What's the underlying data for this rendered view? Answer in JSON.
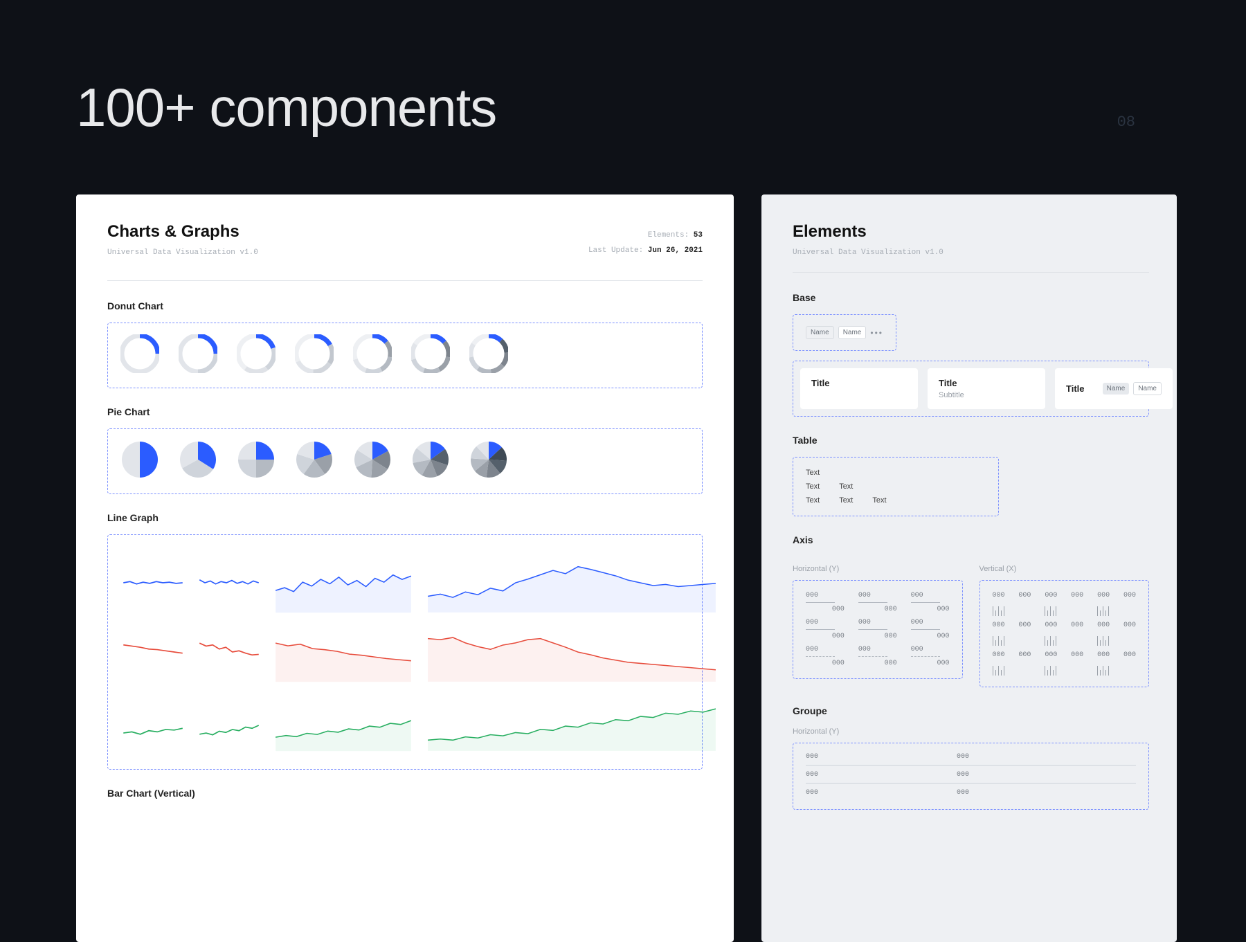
{
  "hero": {
    "title": "100+ components",
    "page_number": "08"
  },
  "left_panel": {
    "title": "Charts & Graphs",
    "subtitle": "Universal Data Visualization v1.0",
    "elements_label": "Elements:",
    "elements_count": "53",
    "update_label": "Last Update:",
    "update_value": "Jun 26, 2021",
    "sections": {
      "donut": "Donut Chart",
      "pie": "Pie Chart",
      "line": "Line Graph",
      "bar_v": "Bar Chart (Vertical)"
    }
  },
  "right_panel": {
    "title": "Elements",
    "subtitle": "Universal Data Visualization v1.0",
    "base": {
      "heading": "Base",
      "chip1": "Name",
      "chip2": "Name",
      "dots": "•••"
    },
    "cards": {
      "c1_title": "Title",
      "c2_title": "Title",
      "c2_sub": "Subtitle",
      "c3_title": "Title",
      "c3_tag1": "Name",
      "c3_tag2": "Name"
    },
    "table": {
      "heading": "Table",
      "cells": [
        "Text",
        "Text",
        "Text",
        "Text",
        "Text",
        "Text"
      ]
    },
    "axis": {
      "heading": "Axis",
      "hlabel": "Horizontal (Y)",
      "vlabel": "Vertical (X)",
      "placeholder": "000"
    },
    "groupe": {
      "heading": "Groupe",
      "sub": "Horizontal (Y)",
      "placeholder": "000"
    }
  },
  "colors": {
    "blue": "#2b5cff",
    "red": "#e74c3c",
    "green": "#27ae60",
    "grey1": "#a7adb5",
    "grey2": "#7d848d",
    "grey3": "#55606b",
    "light": "#e2e5ea"
  },
  "chart_data": [
    {
      "type": "pie",
      "note": "Donut chart variants (ring style). Values approximate filled-arc fractions; segments list slice colors.",
      "variants": [
        {
          "segments": [
            {
              "color": "#2b5cff",
              "value": 25
            },
            {
              "color": "#e2e5ea",
              "value": 75
            }
          ],
          "donut": true
        },
        {
          "segments": [
            {
              "color": "#2b5cff",
              "value": 25
            },
            {
              "color": "#cfd4db",
              "value": 25
            },
            {
              "color": "#e2e5ea",
              "value": 50
            }
          ],
          "donut": true
        },
        {
          "segments": [
            {
              "color": "#2b5cff",
              "value": 20
            },
            {
              "color": "#cfd4db",
              "value": 20
            },
            {
              "color": "#dfe2e7",
              "value": 20
            },
            {
              "color": "#eef0f3",
              "value": 40
            }
          ],
          "donut": true
        },
        {
          "segments": [
            {
              "color": "#2b5cff",
              "value": 17
            },
            {
              "color": "#c2c7ce",
              "value": 17
            },
            {
              "color": "#d2d6dc",
              "value": 17
            },
            {
              "color": "#e2e5ea",
              "value": 17
            },
            {
              "color": "#eef0f3",
              "value": 32
            }
          ],
          "donut": true
        },
        {
          "segments": [
            {
              "color": "#2b5cff",
              "value": 14
            },
            {
              "color": "#9aa0a8",
              "value": 14
            },
            {
              "color": "#b4bac2",
              "value": 14
            },
            {
              "color": "#cfd4db",
              "value": 14
            },
            {
              "color": "#e2e5ea",
              "value": 14
            },
            {
              "color": "#eef0f3",
              "value": 30
            }
          ],
          "donut": true
        },
        {
          "segments": [
            {
              "color": "#2b5cff",
              "value": 14
            },
            {
              "color": "#7d848d",
              "value": 14
            },
            {
              "color": "#9aa0a8",
              "value": 14
            },
            {
              "color": "#b4bac2",
              "value": 14
            },
            {
              "color": "#cfd4db",
              "value": 14
            },
            {
              "color": "#e2e5ea",
              "value": 14
            },
            {
              "color": "#eef0f3",
              "value": 16
            }
          ],
          "donut": true
        },
        {
          "segments": [
            {
              "color": "#2b5cff",
              "value": 12
            },
            {
              "color": "#55606b",
              "value": 12
            },
            {
              "color": "#7d848d",
              "value": 12
            },
            {
              "color": "#9aa0a8",
              "value": 12
            },
            {
              "color": "#b4bac2",
              "value": 12
            },
            {
              "color": "#cfd4db",
              "value": 12
            },
            {
              "color": "#e2e5ea",
              "value": 12
            },
            {
              "color": "#eef0f3",
              "value": 16
            }
          ],
          "donut": true
        }
      ]
    },
    {
      "type": "pie",
      "note": "Solid pie chart variants; equal slices unless blue lead wedge larger.",
      "variants": [
        {
          "segments": [
            {
              "color": "#2b5cff",
              "value": 50
            },
            {
              "color": "#e2e5ea",
              "value": 50
            }
          ]
        },
        {
          "segments": [
            {
              "color": "#2b5cff",
              "value": 34
            },
            {
              "color": "#cfd4db",
              "value": 33
            },
            {
              "color": "#e2e5ea",
              "value": 33
            }
          ]
        },
        {
          "segments": [
            {
              "color": "#2b5cff",
              "value": 25
            },
            {
              "color": "#b4bac2",
              "value": 25
            },
            {
              "color": "#cfd4db",
              "value": 25
            },
            {
              "color": "#e2e5ea",
              "value": 25
            }
          ]
        },
        {
          "segments": [
            {
              "color": "#2b5cff",
              "value": 20
            },
            {
              "color": "#9aa0a8",
              "value": 20
            },
            {
              "color": "#b4bac2",
              "value": 20
            },
            {
              "color": "#cfd4db",
              "value": 20
            },
            {
              "color": "#e2e5ea",
              "value": 20
            }
          ]
        },
        {
          "segments": [
            {
              "color": "#2b5cff",
              "value": 17
            },
            {
              "color": "#7d848d",
              "value": 17
            },
            {
              "color": "#9aa0a8",
              "value": 17
            },
            {
              "color": "#b4bac2",
              "value": 17
            },
            {
              "color": "#cfd4db",
              "value": 16
            },
            {
              "color": "#e2e5ea",
              "value": 16
            }
          ]
        },
        {
          "segments": [
            {
              "color": "#2b5cff",
              "value": 15
            },
            {
              "color": "#55606b",
              "value": 15
            },
            {
              "color": "#7d848d",
              "value": 14
            },
            {
              "color": "#9aa0a8",
              "value": 14
            },
            {
              "color": "#b4bac2",
              "value": 14
            },
            {
              "color": "#cfd4db",
              "value": 14
            },
            {
              "color": "#e2e5ea",
              "value": 14
            }
          ]
        },
        {
          "segments": [
            {
              "color": "#2b5cff",
              "value": 13
            },
            {
              "color": "#3f4a55",
              "value": 13
            },
            {
              "color": "#55606b",
              "value": 13
            },
            {
              "color": "#7d848d",
              "value": 13
            },
            {
              "color": "#9aa0a8",
              "value": 12
            },
            {
              "color": "#b4bac2",
              "value": 12
            },
            {
              "color": "#cfd4db",
              "value": 12
            },
            {
              "color": "#e2e5ea",
              "value": 12
            }
          ]
        }
      ]
    },
    {
      "type": "line",
      "note": "Sparkline examples per color; y in 0..100, x as 0..n.",
      "series": [
        {
          "name": "blue-tiny",
          "color": "#2b5cff",
          "values": [
            50,
            52,
            48,
            51,
            49,
            52,
            50,
            51,
            49,
            50
          ]
        },
        {
          "name": "blue-small",
          "color": "#2b5cff",
          "values": [
            55,
            50,
            53,
            48,
            52,
            50,
            54,
            49,
            52,
            48,
            53,
            50
          ]
        },
        {
          "name": "blue-medium",
          "color": "#2b5cff",
          "values": [
            40,
            45,
            38,
            55,
            48,
            60,
            52,
            64,
            50,
            58,
            47,
            62,
            55,
            68,
            60,
            66
          ]
        },
        {
          "name": "blue-large",
          "color": "#2b5cff",
          "values": [
            30,
            34,
            28,
            38,
            33,
            45,
            40,
            55,
            62,
            70,
            78,
            72,
            85,
            80,
            74,
            68,
            60,
            55,
            50,
            52,
            48,
            50,
            52,
            54
          ]
        },
        {
          "name": "red-tiny",
          "color": "#e74c3c",
          "values": [
            62,
            60,
            58,
            55,
            54,
            52,
            50,
            48
          ]
        },
        {
          "name": "red-small",
          "color": "#e74c3c",
          "values": [
            65,
            60,
            62,
            55,
            58,
            50,
            52,
            48,
            45,
            46
          ]
        },
        {
          "name": "red-medium",
          "color": "#e74c3c",
          "values": [
            70,
            65,
            68,
            60,
            58,
            55,
            50,
            48,
            45,
            42,
            40,
            38
          ]
        },
        {
          "name": "red-large",
          "color": "#e74c3c",
          "values": [
            80,
            78,
            82,
            72,
            65,
            60,
            68,
            72,
            78,
            80,
            72,
            64,
            55,
            50,
            44,
            40,
            36,
            34,
            32,
            30,
            28,
            26,
            24,
            22
          ]
        },
        {
          "name": "green-tiny",
          "color": "#27ae60",
          "values": [
            30,
            32,
            28,
            34,
            32,
            36,
            35,
            38
          ]
        },
        {
          "name": "green-small",
          "color": "#27ae60",
          "values": [
            28,
            30,
            27,
            33,
            31,
            36,
            34,
            40,
            38,
            43
          ]
        },
        {
          "name": "green-medium",
          "color": "#27ae60",
          "values": [
            25,
            28,
            26,
            32,
            30,
            36,
            34,
            40,
            38,
            45,
            43,
            50,
            48,
            55
          ]
        },
        {
          "name": "green-large",
          "color": "#27ae60",
          "values": [
            20,
            22,
            20,
            26,
            24,
            30,
            28,
            34,
            32,
            40,
            38,
            46,
            44,
            52,
            50,
            58,
            56,
            64,
            62,
            70,
            68,
            74,
            72,
            78
          ]
        }
      ]
    }
  ]
}
